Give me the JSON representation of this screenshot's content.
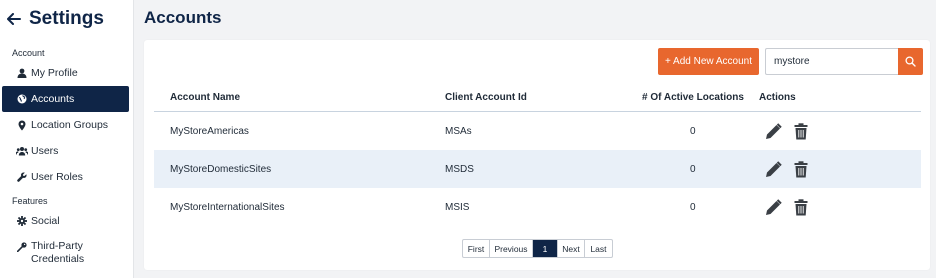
{
  "sidebar": {
    "title": "Settings",
    "sections": [
      {
        "label": "Account",
        "items": [
          {
            "label": "My Profile",
            "icon": "user-icon"
          },
          {
            "label": "Accounts",
            "icon": "globe-icon",
            "active": true
          },
          {
            "label": "Location Groups",
            "icon": "map-pin-icon"
          },
          {
            "label": "Users",
            "icon": "users-icon"
          },
          {
            "label": "User Roles",
            "icon": "wrench-icon"
          }
        ]
      },
      {
        "label": "Features",
        "items": [
          {
            "label": "Social",
            "icon": "gear-icon"
          },
          {
            "label": "Third-Party Credentials",
            "icon": "key-icon"
          }
        ]
      }
    ]
  },
  "main": {
    "title": "Accounts",
    "add_button": "+ Add New Account",
    "search_value": "mystore",
    "columns": [
      "Account Name",
      "Client Account Id",
      "# Of Active Locations",
      "Actions"
    ],
    "rows": [
      {
        "name": "MyStoreAmericas",
        "client_id": "MSAs",
        "locations": "0"
      },
      {
        "name": "MyStoreDomesticSites",
        "client_id": "MSDS",
        "locations": "0"
      },
      {
        "name": "MyStoreInternationalSites",
        "client_id": "MSIS",
        "locations": "0"
      }
    ],
    "pagination": {
      "first": "First",
      "previous": "Previous",
      "current": "1",
      "next": "Next",
      "last": "Last"
    }
  },
  "colors": {
    "accent": "#e8672e",
    "navy": "#0f2547",
    "row_highlight": "#e9f0f8"
  }
}
